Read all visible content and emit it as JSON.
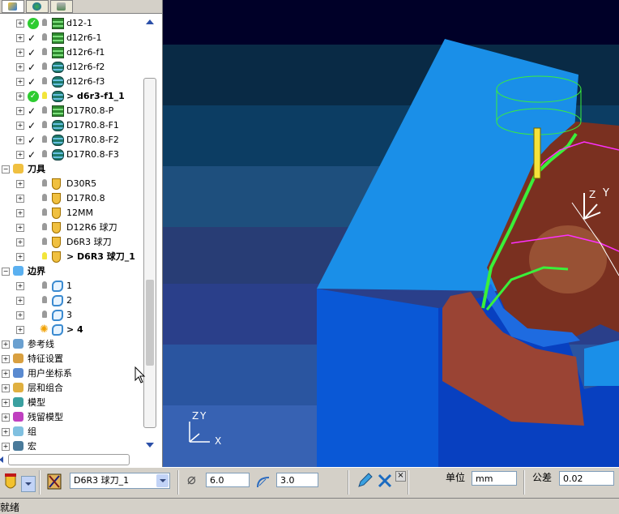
{
  "tree": {
    "items": [
      {
        "label": "d12-1",
        "check": "green",
        "bulb": "off",
        "icon": "stack",
        "indent": 1,
        "bold": false
      },
      {
        "label": "d12r6-1",
        "check": "tick",
        "bulb": "off",
        "icon": "stack",
        "indent": 1,
        "bold": false
      },
      {
        "label": "d12r6-f1",
        "check": "tick",
        "bulb": "off",
        "icon": "stack",
        "indent": 1,
        "bold": false
      },
      {
        "label": "d12r6-f2",
        "check": "tick",
        "bulb": "off",
        "icon": "stack-round",
        "indent": 1,
        "bold": false
      },
      {
        "label": "d12r6-f3",
        "check": "tick",
        "bulb": "off",
        "icon": "stack-round",
        "indent": 1,
        "bold": false
      },
      {
        "label": "> d6r3-f1_1",
        "check": "green",
        "bulb": "on",
        "icon": "stack-round",
        "indent": 1,
        "bold": true
      },
      {
        "label": "D17R0.8-P",
        "check": "tick",
        "bulb": "off",
        "icon": "stack",
        "indent": 1,
        "bold": false
      },
      {
        "label": "D17R0.8-F1",
        "check": "tick",
        "bulb": "off",
        "icon": "stack-teal",
        "indent": 1,
        "bold": false
      },
      {
        "label": "D17R0.8-F2",
        "check": "tick",
        "bulb": "off",
        "icon": "stack-teal",
        "indent": 1,
        "bold": false
      },
      {
        "label": "D17R0.8-F3",
        "check": "tick",
        "bulb": "off",
        "icon": "stack-teal",
        "indent": 1,
        "bold": false
      },
      {
        "label": "刀具",
        "check": "",
        "bulb": "",
        "icon": "tools-group",
        "indent": 0,
        "bold": true
      },
      {
        "label": "D30R5",
        "check": "",
        "bulb": "off",
        "icon": "tool",
        "indent": 1,
        "bold": false
      },
      {
        "label": "D17R0.8",
        "check": "",
        "bulb": "off",
        "icon": "tool",
        "indent": 1,
        "bold": false
      },
      {
        "label": "12MM",
        "check": "",
        "bulb": "off",
        "icon": "tool",
        "indent": 1,
        "bold": false
      },
      {
        "label": "D12R6 球刀",
        "check": "",
        "bulb": "off",
        "icon": "tool",
        "indent": 1,
        "bold": false
      },
      {
        "label": "D6R3 球刀",
        "check": "",
        "bulb": "off",
        "icon": "tool",
        "indent": 1,
        "bold": false
      },
      {
        "label": "> D6R3 球刀_1",
        "check": "",
        "bulb": "on",
        "icon": "tool",
        "indent": 1,
        "bold": true
      },
      {
        "label": "边界",
        "check": "",
        "bulb": "",
        "icon": "boundary-group",
        "indent": 0,
        "bold": true
      },
      {
        "label": "1",
        "check": "",
        "bulb": "off",
        "icon": "boundary",
        "indent": 1,
        "bold": false
      },
      {
        "label": "2",
        "check": "",
        "bulb": "off",
        "icon": "boundary-stack",
        "indent": 1,
        "bold": false
      },
      {
        "label": "3",
        "check": "",
        "bulb": "off",
        "icon": "boundary-stack",
        "indent": 1,
        "bold": false
      },
      {
        "label": "> 4",
        "check": "",
        "bulb": "sun",
        "icon": "boundary-stack",
        "indent": 1,
        "bold": true
      },
      {
        "label": "参考线",
        "check": "",
        "bulb": "",
        "icon": "pattern",
        "indent": 0,
        "bold": false
      },
      {
        "label": "特征设置",
        "check": "",
        "bulb": "",
        "icon": "feature",
        "indent": 0,
        "bold": false
      },
      {
        "label": "用户坐标系",
        "check": "",
        "bulb": "",
        "icon": "ucs",
        "indent": 0,
        "bold": false
      },
      {
        "label": "层和组合",
        "check": "",
        "bulb": "",
        "icon": "layers",
        "indent": 0,
        "bold": false
      },
      {
        "label": "模型",
        "check": "",
        "bulb": "",
        "icon": "model",
        "indent": 0,
        "bold": false
      },
      {
        "label": "残留模型",
        "check": "",
        "bulb": "",
        "icon": "stock",
        "indent": 0,
        "bold": false
      },
      {
        "label": "组",
        "check": "",
        "bulb": "",
        "icon": "group",
        "indent": 0,
        "bold": false
      },
      {
        "label": "宏",
        "check": "",
        "bulb": "",
        "icon": "macro",
        "indent": 0,
        "bold": false
      }
    ]
  },
  "viewport": {
    "axis_labels": {
      "z": "Z",
      "y": "Y",
      "x": "X"
    },
    "model_axis": {
      "z": "Z",
      "x": "X",
      "y": "Y"
    },
    "bands": [
      "#000028",
      "#092a45",
      "#0c3d63",
      "#1e4f7d",
      "#283d75",
      "#2a3f8a",
      "#2a55a0",
      "#3762b3"
    ]
  },
  "toolbar": {
    "tool_select": "D6R3 球刀_1",
    "diameter": "6.0",
    "tip_radius": "3.0",
    "unit_label": "单位",
    "unit_value": "mm",
    "tolerance_label": "公差",
    "tolerance_value": "0.02"
  },
  "status": {
    "text": "就绪"
  }
}
